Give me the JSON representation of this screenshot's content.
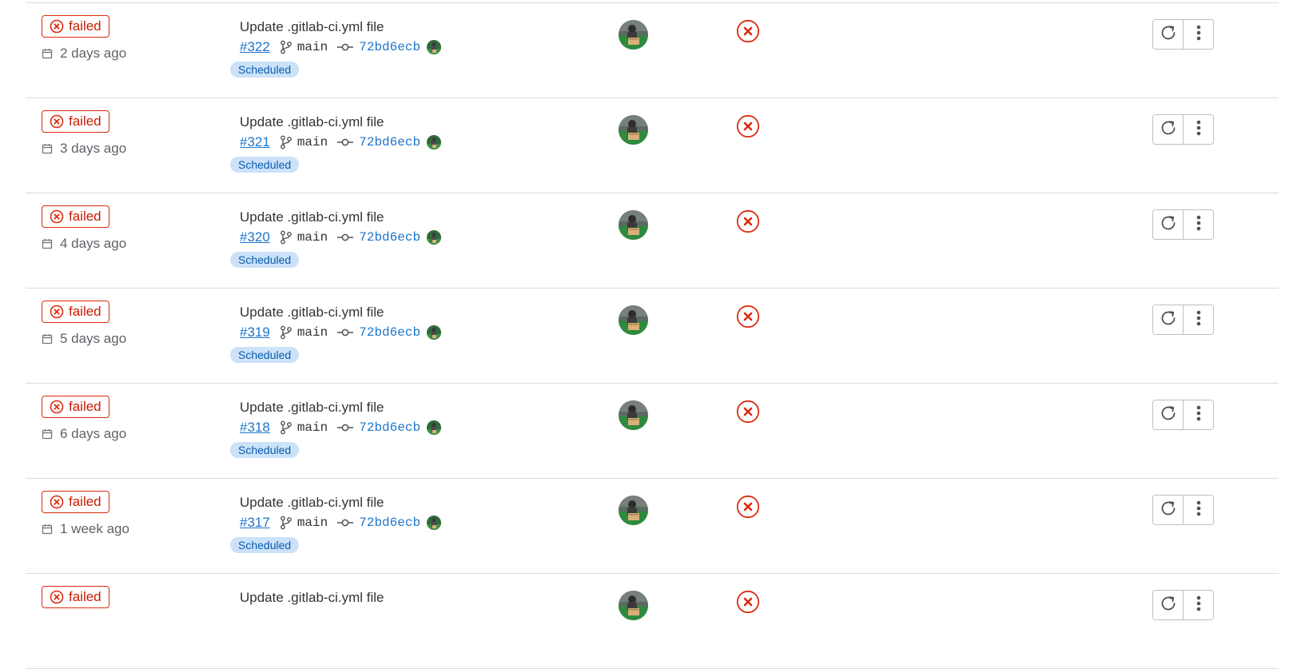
{
  "pipelines": [
    {
      "status": "failed",
      "time": "2 days ago",
      "commit_title": "Update .gitlab-ci.yml file",
      "id": "#322",
      "branch": "main",
      "sha": "72bd6ecb",
      "tag": "Scheduled"
    },
    {
      "status": "failed",
      "time": "3 days ago",
      "commit_title": "Update .gitlab-ci.yml file",
      "id": "#321",
      "branch": "main",
      "sha": "72bd6ecb",
      "tag": "Scheduled"
    },
    {
      "status": "failed",
      "time": "4 days ago",
      "commit_title": "Update .gitlab-ci.yml file",
      "id": "#320",
      "branch": "main",
      "sha": "72bd6ecb",
      "tag": "Scheduled"
    },
    {
      "status": "failed",
      "time": "5 days ago",
      "commit_title": "Update .gitlab-ci.yml file",
      "id": "#319",
      "branch": "main",
      "sha": "72bd6ecb",
      "tag": "Scheduled"
    },
    {
      "status": "failed",
      "time": "6 days ago",
      "commit_title": "Update .gitlab-ci.yml file",
      "id": "#318",
      "branch": "main",
      "sha": "72bd6ecb",
      "tag": "Scheduled"
    },
    {
      "status": "failed",
      "time": "1 week ago",
      "commit_title": "Update .gitlab-ci.yml file",
      "id": "#317",
      "branch": "main",
      "sha": "72bd6ecb",
      "tag": "Scheduled"
    },
    {
      "status": "failed",
      "time": "",
      "commit_title": "Update .gitlab-ci.yml file",
      "id": "",
      "branch": "",
      "sha": "",
      "tag": ""
    }
  ],
  "colors": {
    "failed": "#dd2b0e",
    "link": "#1f75cb",
    "tag_bg": "#cbe2f9",
    "tag_text": "#0b5cad",
    "border": "#dcdcde"
  },
  "icons": {
    "status": "status-failed-icon",
    "time": "calendar-icon",
    "branch": "branch-icon",
    "commit": "commit-icon",
    "stage": "stage-failed-icon",
    "retry": "retry-icon",
    "more": "ellipsis-vertical-icon"
  }
}
